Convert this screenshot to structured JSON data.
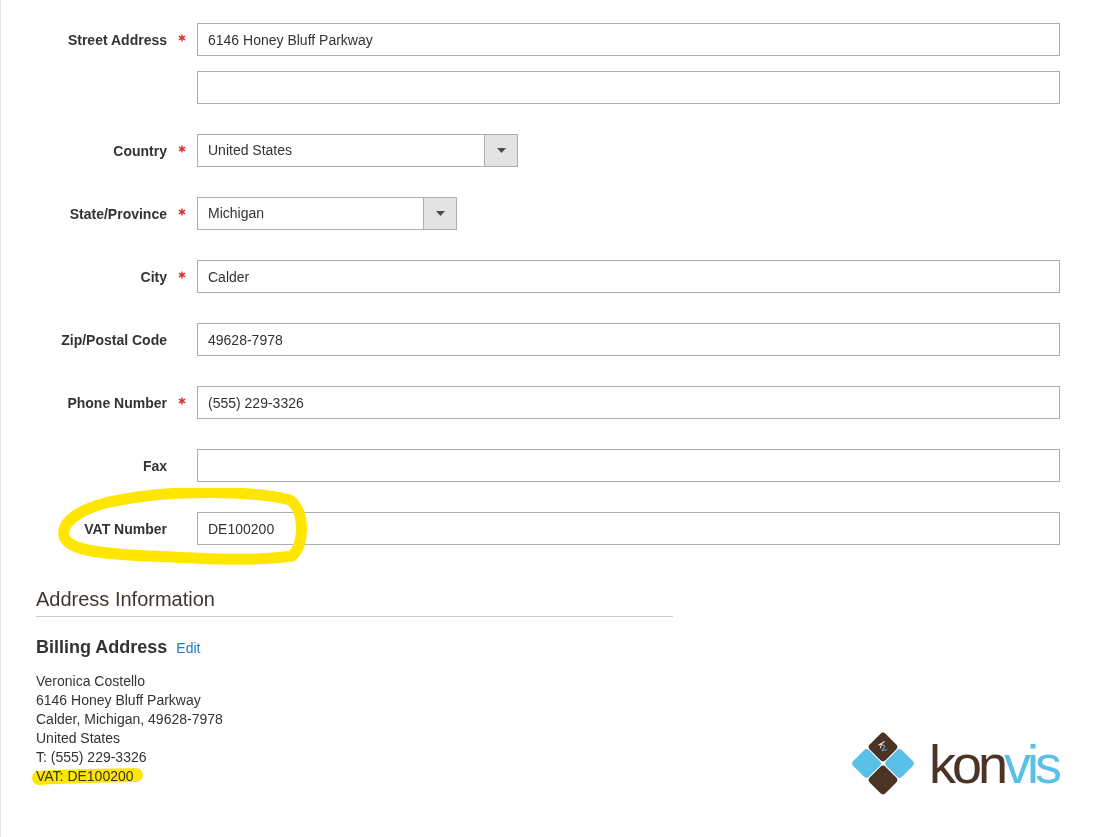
{
  "fields": [
    {
      "kind": "text",
      "label": "Street Address",
      "required": true,
      "value": "6146 Honey Bluff Parkway",
      "highlighted": false
    },
    {
      "kind": "text",
      "required": false,
      "highlighted": false
    },
    {
      "kind": "select",
      "label": "Country",
      "required": true,
      "value": "United States",
      "highlighted": false
    },
    {
      "kind": "select",
      "label": "State/Province",
      "required": true,
      "value": "Michigan",
      "highlighted": false
    },
    {
      "kind": "text",
      "label": "City",
      "required": true,
      "value": "Calder",
      "highlighted": false
    },
    {
      "kind": "text",
      "label": "Zip/Postal Code",
      "required": false,
      "value": "49628-7978",
      "highlighted": false
    },
    {
      "kind": "text",
      "label": "Phone Number",
      "required": true,
      "value": "(555) 229-3326",
      "highlighted": false
    },
    {
      "kind": "text",
      "label": "Fax",
      "required": false,
      "highlighted": false
    },
    {
      "kind": "text",
      "label": "VAT Number",
      "required": false,
      "value": "DE100200",
      "highlighted": true
    }
  ],
  "address_information": {
    "title": "Address Information",
    "billing_address": {
      "title": "Billing Address",
      "edit_link": "Edit",
      "lines": [
        {
          "text": "Veronica Costello",
          "highlighted": false
        },
        {
          "text": "6146 Honey Bluff Parkway",
          "highlighted": false
        },
        {
          "text": "Calder, Michigan, 49628-7978",
          "highlighted": false
        },
        {
          "text": "United States",
          "highlighted": false
        },
        {
          "text": "T: (555) 229-3326",
          "highlighted": false
        },
        {
          "text": "VAT: DE100200",
          "highlighted": true
        }
      ]
    }
  },
  "logo": {
    "monogram": "kv",
    "wordmark": [
      {
        "text": "kon",
        "color": "#4b3325"
      },
      {
        "text": "vis",
        "color": "#5bc0e8"
      }
    ]
  }
}
